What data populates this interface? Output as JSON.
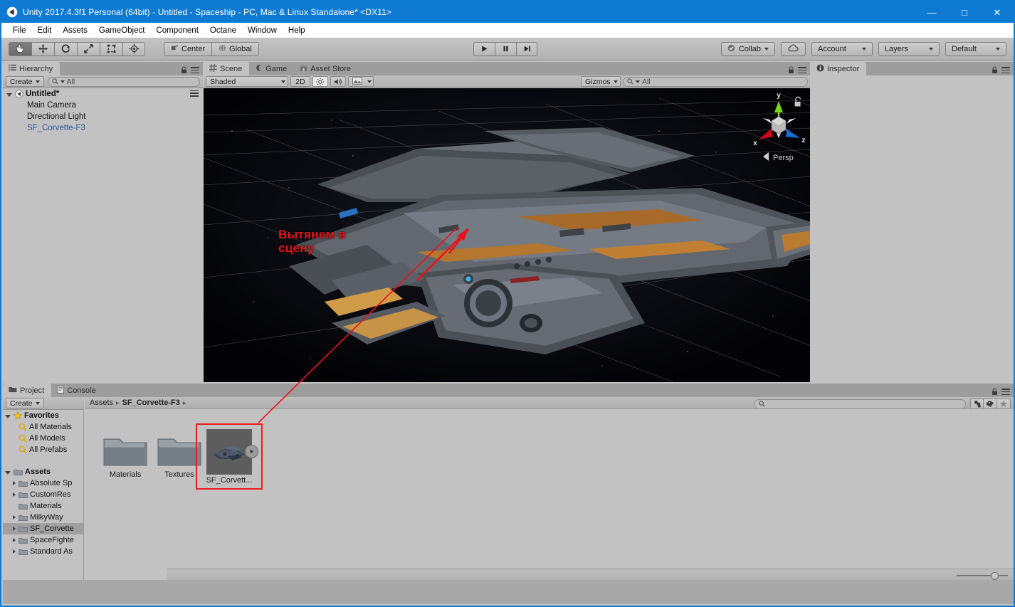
{
  "window": {
    "title": "Unity 2017.4.3f1 Personal (64bit) - Untitled - Spaceship - PC, Mac & Linux Standalone* <DX11>",
    "logo_icon": "unity-logo-icon",
    "minimize_label": "—",
    "maximize_label": "□",
    "close_label": "✕",
    "titlebar_color": "#0e7ad1"
  },
  "menubar": {
    "items": [
      "File",
      "Edit",
      "Assets",
      "GameObject",
      "Component",
      "Octane",
      "Window",
      "Help"
    ]
  },
  "toolbar": {
    "transform_tools": [
      {
        "name": "hand-tool",
        "glyph": "✋",
        "active": true
      },
      {
        "name": "move-tool",
        "glyph": "✥",
        "active": false
      },
      {
        "name": "rotate-tool",
        "glyph": "↻",
        "active": false
      },
      {
        "name": "scale-tool",
        "glyph": "⤡",
        "active": false
      },
      {
        "name": "rect-tool",
        "glyph": "⬚",
        "active": false
      },
      {
        "name": "transform-tool",
        "glyph": "✣",
        "active": false
      }
    ],
    "pivot_mode": "Center",
    "pivot_rotation": "Global",
    "play_label": "▶",
    "pause_label": "❚❚",
    "step_label": "▶█",
    "collab_label": "Collab",
    "cloud_icon": "cloud-icon",
    "account_label": "Account",
    "layers_label": "Layers",
    "layout_label": "Default"
  },
  "hierarchy": {
    "tab_label": "Hierarchy",
    "tab_icon": "hierarchy-icon",
    "create_label": "Create",
    "search_placeholder": "All",
    "search_value": "",
    "items": [
      {
        "label": "Untitled*",
        "depth": 0,
        "type": "scene",
        "expanded": true
      },
      {
        "label": "Main Camera",
        "depth": 1,
        "type": "gameobject"
      },
      {
        "label": "Directional Light",
        "depth": 1,
        "type": "gameobject"
      },
      {
        "label": "SF_Corvette-F3",
        "depth": 1,
        "type": "prefab"
      }
    ]
  },
  "scene": {
    "tabs": [
      {
        "label": "Scene",
        "icon": "scene-grid-icon",
        "active": true
      },
      {
        "label": "Game",
        "icon": "game-icon",
        "active": false
      },
      {
        "label": "Asset Store",
        "icon": "asset-store-icon",
        "active": false
      }
    ],
    "draw_mode": "Shaded",
    "mode_2d_label": "2D",
    "lighting_icon": "sun-icon",
    "audio_icon": "speaker-icon",
    "effects_icon": "image-icon",
    "gizmos_label": "Gizmos",
    "scene_search_placeholder": "All",
    "gizmo": {
      "y_label": "y",
      "x_label": "x",
      "z_label": "z",
      "projection_label": "Persp",
      "y_color": "#7ed321",
      "x_color": "#d0021b",
      "z_color": "#1a6fd4"
    },
    "annotation": {
      "line1": "Вытянем в",
      "line2": "сцену",
      "color": "#e8131a"
    }
  },
  "inspector": {
    "tab_label": "Inspector",
    "tab_icon": "info-icon",
    "lock_icon": "lock-icon",
    "menu_icon": "panel-menu-icon"
  },
  "project": {
    "tabs": [
      {
        "label": "Project",
        "icon": "folder-icon",
        "active": true
      },
      {
        "label": "Console",
        "icon": "console-icon",
        "active": false
      }
    ],
    "create_label": "Create",
    "search_placeholder": "",
    "search_value": "",
    "filters": [
      {
        "name": "type-filter-icon"
      },
      {
        "name": "label-filter-icon"
      },
      {
        "name": "favorite-filter-icon"
      }
    ],
    "breadcrumb": [
      "Assets",
      "SF_Corvette-F3"
    ],
    "tree": [
      {
        "label": "Favorites",
        "depth": 0,
        "type": "favorites",
        "expanded": true,
        "bold": true
      },
      {
        "label": "All Materials",
        "depth": 1,
        "type": "search"
      },
      {
        "label": "All Models",
        "depth": 1,
        "type": "search"
      },
      {
        "label": "All Prefabs",
        "depth": 1,
        "type": "search"
      },
      {
        "label": "",
        "depth": 0,
        "type": "gap"
      },
      {
        "label": "Assets",
        "depth": 0,
        "type": "folder",
        "expanded": true,
        "bold": true
      },
      {
        "label": "Absolute Sp",
        "depth": 1,
        "type": "folder",
        "collapsed": true
      },
      {
        "label": "CustomRes",
        "depth": 1,
        "type": "folder",
        "collapsed": true
      },
      {
        "label": "Materials",
        "depth": 1,
        "type": "folder"
      },
      {
        "label": "MilkyWay",
        "depth": 1,
        "type": "folder",
        "collapsed": true
      },
      {
        "label": "SF_Corvette",
        "depth": 1,
        "type": "folder",
        "collapsed": true,
        "selected": true
      },
      {
        "label": "SpaceFighte",
        "depth": 1,
        "type": "folder",
        "collapsed": true
      },
      {
        "label": "Standard As",
        "depth": 1,
        "type": "folder",
        "collapsed": true
      }
    ],
    "assets": [
      {
        "label": "Materials",
        "kind": "folder"
      },
      {
        "label": "Textures",
        "kind": "folder"
      },
      {
        "label": "SF_Corvett...",
        "kind": "prefab",
        "highlighted": true,
        "highlight_color": "#ef1b24"
      }
    ],
    "zoom_value": 66
  }
}
